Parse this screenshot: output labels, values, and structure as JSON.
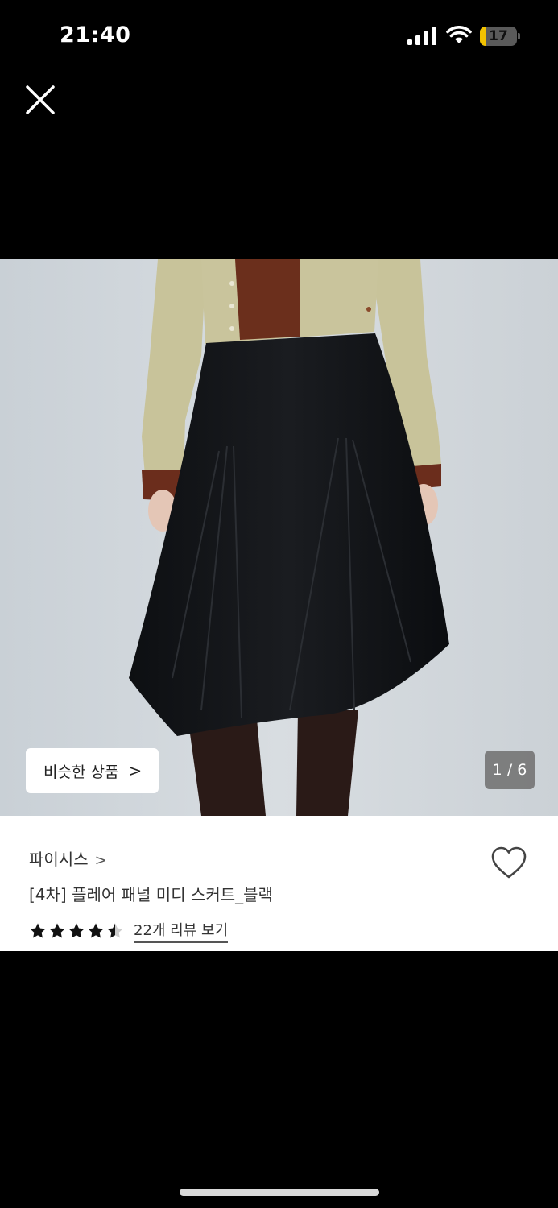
{
  "status_bar": {
    "time": "21:40",
    "battery_level": "17",
    "battery_fraction": 0.17
  },
  "viewer": {
    "close_icon": "close-icon",
    "similar_button_label": "비슷한 상품",
    "similar_button_chevron": ">",
    "page_indicator": "1 / 6"
  },
  "product": {
    "brand": "파이시스",
    "brand_chevron": ">",
    "title": "[4차] 플레어 패널 미디 스커트_블랙",
    "rating": 4.5,
    "review_link": "22개 리뷰 보기",
    "wishlist_icon": "heart-outline-icon"
  },
  "colors": {
    "background": "#000000",
    "battery": "#f2c200",
    "panel": "#ffffff"
  }
}
